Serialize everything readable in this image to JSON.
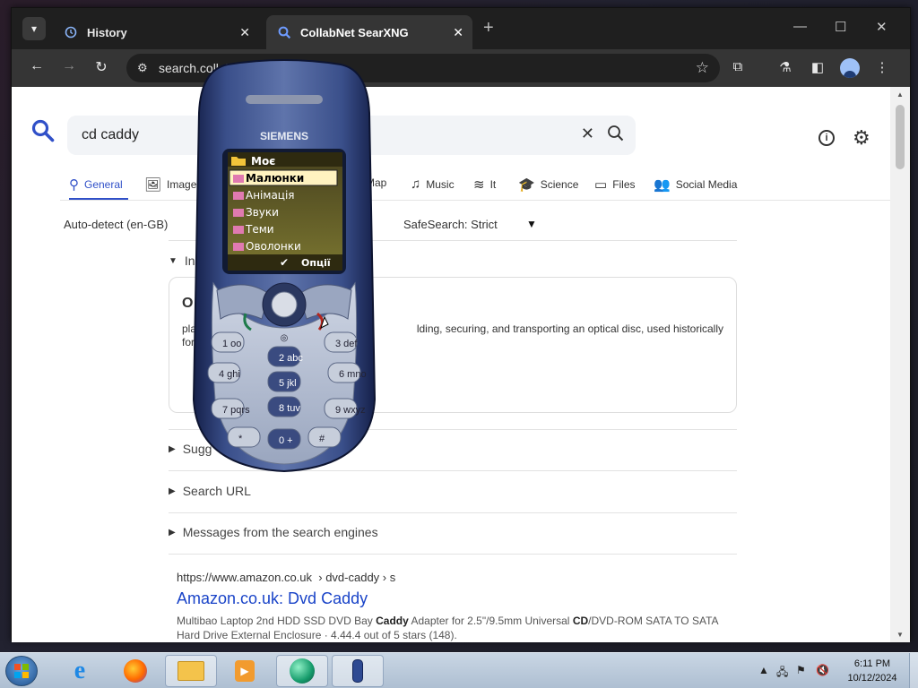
{
  "tabs": [
    {
      "label": "History",
      "icon": "history-icon"
    },
    {
      "label": "CollabNet SearXNG",
      "icon": "search-icon"
    }
  ],
  "address": {
    "url": "search.collab"
  },
  "search": {
    "query": "cd  caddy"
  },
  "categories": [
    "General",
    "Images",
    "Map",
    "Music",
    "It",
    "Science",
    "Files",
    "Social Media"
  ],
  "filters": {
    "language": "Auto-detect (en-GB)",
    "safesearch": "SafeSearch: Strict"
  },
  "infobox": {
    "section_label": "In",
    "title": "O",
    "text_left": "pla",
    "text_left2": "for",
    "text_right": "lding, securing, and transporting an optical disc, used historically"
  },
  "sections": {
    "suggestions": "Sugg",
    "search_url": "Search URL",
    "messages": "Messages from the search engines"
  },
  "result": {
    "url": "https://www.amazon.co.uk",
    "breadcrumb": "› dvd-caddy › s",
    "title": "Amazon.co.uk: Dvd Caddy",
    "snippet_a": "Multibao Laptop 2nd HDD SSD DVD Bay ",
    "snippet_b": "Caddy",
    "snippet_c": " Adapter for 2.5\"/9.5mm Universal ",
    "snippet_d": "CD",
    "snippet_e": "/DVD-ROM SATA TO SATA Hard Drive External Enclosure · 4.44.4 out of 5 stars (148)."
  },
  "phone": {
    "brand": "SIEMENS",
    "menu_title": "Моє",
    "items": [
      "Малюнки",
      "Анімація",
      "Звуки",
      "Теми",
      "Оволонки"
    ],
    "softkey": "Опції",
    "keys": [
      "1",
      "2",
      "3",
      "4",
      "5",
      "6",
      "7",
      "8",
      "9",
      "*",
      "0",
      "#"
    ],
    "keys_letters": [
      "oo",
      "abc",
      "def",
      "ghi",
      "jkl",
      "mno",
      "pqrs",
      "tuv",
      "wxyz"
    ],
    "key_zero_extra": "+"
  },
  "clock": {
    "time": "6:11 PM",
    "date": "10/12/2024"
  },
  "colors": {
    "accent": "#3050c8",
    "link": "#1a44c8",
    "phone_body": "#2b3b6b"
  }
}
